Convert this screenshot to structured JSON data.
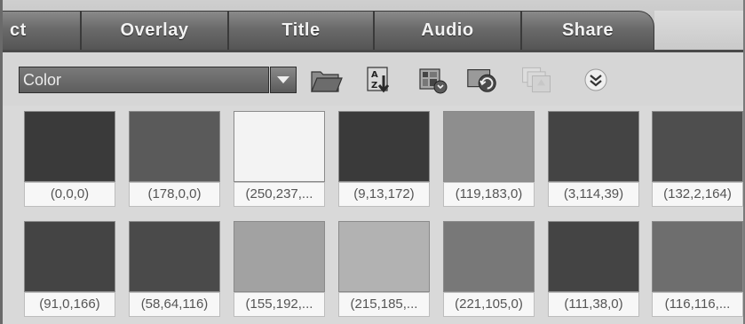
{
  "tabs": [
    {
      "label": "ct"
    },
    {
      "label": "Overlay"
    },
    {
      "label": "Title"
    },
    {
      "label": "Audio"
    },
    {
      "label": "Share"
    }
  ],
  "toolbar": {
    "category_value": "Color",
    "icons": [
      "folder-open-icon",
      "sort-az-icon",
      "view-options-icon",
      "library-sync-icon",
      "add-item-icon",
      "expand-more-icon"
    ]
  },
  "swatches": [
    {
      "label": "(0,0,0)",
      "color": "#3a3a3a"
    },
    {
      "label": "(178,0,0)",
      "color": "#5a5a5a"
    },
    {
      "label": "(250,237,...",
      "color": "#f3f3f3"
    },
    {
      "label": "(9,13,172)",
      "color": "#3a3a3a"
    },
    {
      "label": "(119,183,0)",
      "color": "#8e8e8e"
    },
    {
      "label": "(3,114,39)",
      "color": "#444444"
    },
    {
      "label": "(132,2,164)",
      "color": "#4e4e4e"
    },
    {
      "label": "(91,0,166)",
      "color": "#444444"
    },
    {
      "label": "(58,64,116)",
      "color": "#4a4a4a"
    },
    {
      "label": "(155,192,...",
      "color": "#a2a2a2"
    },
    {
      "label": "(215,185,...",
      "color": "#b2b2b2"
    },
    {
      "label": "(221,105,0)",
      "color": "#787878"
    },
    {
      "label": "(111,38,0)",
      "color": "#444444"
    },
    {
      "label": "(116,116,...",
      "color": "#6e6e6e"
    }
  ]
}
